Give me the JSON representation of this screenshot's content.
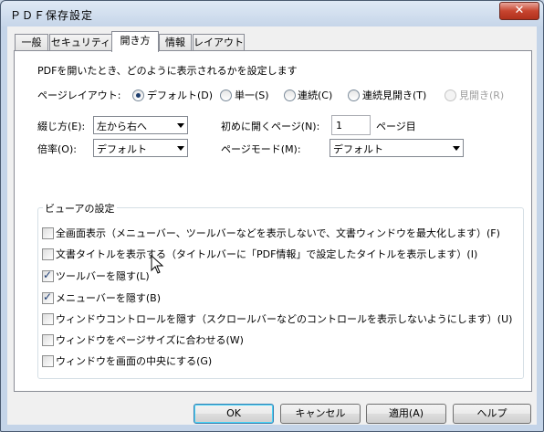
{
  "window": {
    "title": "ＰＤＦ保存設定",
    "close_glyph": "✕"
  },
  "tabs": [
    {
      "label": "一般"
    },
    {
      "label": "セキュリティ"
    },
    {
      "label": "開き方"
    },
    {
      "label": "情報"
    },
    {
      "label": "レイアウト"
    }
  ],
  "open_tab": {
    "description": "PDFを開いたとき、どのように表示されるかを設定します",
    "page_layout": {
      "label": "ページレイアウト:",
      "options": [
        "デフォルト(D)",
        "単一(S)",
        "連続(C)",
        "連続見開き(T)",
        "見開き(R)"
      ],
      "selected": "デフォルト(D)"
    },
    "binding": {
      "label": "綴じ方(E):",
      "value": "左から右へ"
    },
    "first_page": {
      "label": "初めに開くページ(N):",
      "value": "1",
      "suffix": "ページ目"
    },
    "zoom": {
      "label": "倍率(O):",
      "value": "デフォルト"
    },
    "page_mode": {
      "label": "ページモード(M):",
      "value": "デフォルト"
    },
    "viewer": {
      "title": "ビューアの設定",
      "options": [
        {
          "label": "全画面表示（メニューバー、ツールバーなどを表示しないで、文書ウィンドウを最大化します）(F)",
          "checked": false
        },
        {
          "label": "文書タイトルを表示する（タイトルバーに「PDF情報」で設定したタイトルを表示します）(I)",
          "checked": false
        },
        {
          "label": "ツールバーを隠す(L)",
          "checked": true
        },
        {
          "label": "メニューバーを隠す(B)",
          "checked": true
        },
        {
          "label": "ウィンドウコントロールを隠す（スクロールバーなどのコントロールを表示しないようにします）(U)",
          "checked": false
        },
        {
          "label": "ウィンドウをページサイズに合わせる(W)",
          "checked": false
        },
        {
          "label": "ウィンドウを画面の中央にする(G)",
          "checked": false
        }
      ]
    }
  },
  "buttons": {
    "ok": "OK",
    "cancel": "キャンセル",
    "apply": "適用(A)",
    "help": "ヘルプ"
  },
  "colors": {
    "title_bar": "#c4d4e8",
    "close_button": "#c7452f",
    "check": "#1d3c72"
  }
}
